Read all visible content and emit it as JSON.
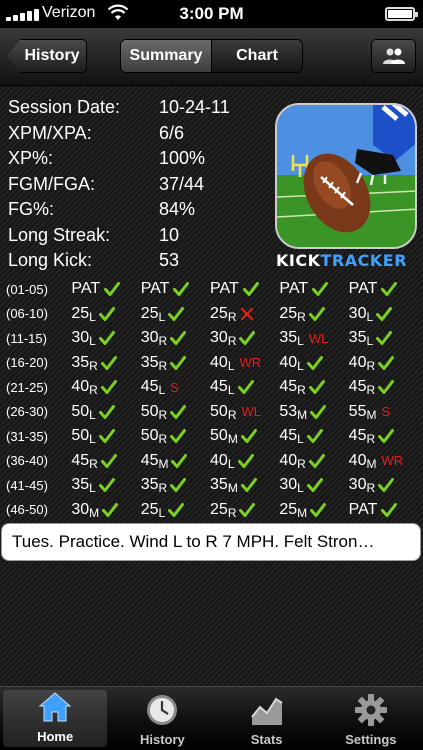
{
  "status": {
    "carrier": "Verizon",
    "time": "3:00 PM"
  },
  "nav": {
    "back_label": "History",
    "segments": [
      {
        "label": "Summary",
        "active": true
      },
      {
        "label": "Chart",
        "active": false
      }
    ],
    "right_icon": "person-icon"
  },
  "summary": [
    {
      "label": "Session Date:",
      "value": "10-24-11"
    },
    {
      "label": "XPM/XPA:",
      "value": "6/6"
    },
    {
      "label": "XP%:",
      "value": "100%"
    },
    {
      "label": "FGM/FGA:",
      "value": "37/44"
    },
    {
      "label": "FG%:",
      "value": "84%"
    },
    {
      "label": "Long Streak:",
      "value": "10"
    },
    {
      "label": "Long Kick:",
      "value": "53"
    }
  ],
  "logo": {
    "part1": "KICK",
    "part2": "TRACKER"
  },
  "kicks": [
    {
      "range": "(01-05)",
      "cells": [
        {
          "dist": "PAT",
          "dir": "",
          "made": true,
          "miss": ""
        },
        {
          "dist": "PAT",
          "dir": "",
          "made": true,
          "miss": ""
        },
        {
          "dist": "PAT",
          "dir": "",
          "made": true,
          "miss": ""
        },
        {
          "dist": "PAT",
          "dir": "",
          "made": true,
          "miss": ""
        },
        {
          "dist": "PAT",
          "dir": "",
          "made": true,
          "miss": ""
        }
      ]
    },
    {
      "range": "(06-10)",
      "cells": [
        {
          "dist": "25",
          "dir": "L",
          "made": true,
          "miss": ""
        },
        {
          "dist": "25",
          "dir": "L",
          "made": true,
          "miss": ""
        },
        {
          "dist": "25",
          "dir": "R",
          "made": false,
          "miss": "X"
        },
        {
          "dist": "25",
          "dir": "R",
          "made": true,
          "miss": ""
        },
        {
          "dist": "30",
          "dir": "L",
          "made": true,
          "miss": ""
        }
      ]
    },
    {
      "range": "(11-15)",
      "cells": [
        {
          "dist": "30",
          "dir": "L",
          "made": true,
          "miss": ""
        },
        {
          "dist": "30",
          "dir": "R",
          "made": true,
          "miss": ""
        },
        {
          "dist": "30",
          "dir": "R",
          "made": true,
          "miss": ""
        },
        {
          "dist": "35",
          "dir": "L",
          "made": false,
          "miss": "WL"
        },
        {
          "dist": "35",
          "dir": "L",
          "made": true,
          "miss": ""
        }
      ]
    },
    {
      "range": "(16-20)",
      "cells": [
        {
          "dist": "35",
          "dir": "R",
          "made": true,
          "miss": ""
        },
        {
          "dist": "35",
          "dir": "R",
          "made": true,
          "miss": ""
        },
        {
          "dist": "40",
          "dir": "L",
          "made": false,
          "miss": "WR"
        },
        {
          "dist": "40",
          "dir": "L",
          "made": true,
          "miss": ""
        },
        {
          "dist": "40",
          "dir": "R",
          "made": true,
          "miss": ""
        }
      ]
    },
    {
      "range": "(21-25)",
      "cells": [
        {
          "dist": "40",
          "dir": "R",
          "made": true,
          "miss": ""
        },
        {
          "dist": "45",
          "dir": "L",
          "made": false,
          "miss": "S"
        },
        {
          "dist": "45",
          "dir": "L",
          "made": true,
          "miss": ""
        },
        {
          "dist": "45",
          "dir": "R",
          "made": true,
          "miss": ""
        },
        {
          "dist": "45",
          "dir": "R",
          "made": true,
          "miss": ""
        }
      ]
    },
    {
      "range": "(26-30)",
      "cells": [
        {
          "dist": "50",
          "dir": "L",
          "made": true,
          "miss": ""
        },
        {
          "dist": "50",
          "dir": "R",
          "made": true,
          "miss": ""
        },
        {
          "dist": "50",
          "dir": "R",
          "made": false,
          "miss": "WL"
        },
        {
          "dist": "53",
          "dir": "M",
          "made": true,
          "miss": ""
        },
        {
          "dist": "55",
          "dir": "M",
          "made": false,
          "miss": "S"
        }
      ]
    },
    {
      "range": "(31-35)",
      "cells": [
        {
          "dist": "50",
          "dir": "L",
          "made": true,
          "miss": ""
        },
        {
          "dist": "50",
          "dir": "R",
          "made": true,
          "miss": ""
        },
        {
          "dist": "50",
          "dir": "M",
          "made": true,
          "miss": ""
        },
        {
          "dist": "45",
          "dir": "L",
          "made": true,
          "miss": ""
        },
        {
          "dist": "45",
          "dir": "R",
          "made": true,
          "miss": ""
        }
      ]
    },
    {
      "range": "(36-40)",
      "cells": [
        {
          "dist": "45",
          "dir": "R",
          "made": true,
          "miss": ""
        },
        {
          "dist": "45",
          "dir": "M",
          "made": true,
          "miss": ""
        },
        {
          "dist": "40",
          "dir": "L",
          "made": true,
          "miss": ""
        },
        {
          "dist": "40",
          "dir": "R",
          "made": true,
          "miss": ""
        },
        {
          "dist": "40",
          "dir": "M",
          "made": false,
          "miss": "WR"
        }
      ]
    },
    {
      "range": "(41-45)",
      "cells": [
        {
          "dist": "35",
          "dir": "L",
          "made": true,
          "miss": ""
        },
        {
          "dist": "35",
          "dir": "R",
          "made": true,
          "miss": ""
        },
        {
          "dist": "35",
          "dir": "M",
          "made": true,
          "miss": ""
        },
        {
          "dist": "30",
          "dir": "L",
          "made": true,
          "miss": ""
        },
        {
          "dist": "30",
          "dir": "R",
          "made": true,
          "miss": ""
        }
      ]
    },
    {
      "range": "(46-50)",
      "cells": [
        {
          "dist": "30",
          "dir": "M",
          "made": true,
          "miss": ""
        },
        {
          "dist": "25",
          "dir": "L",
          "made": true,
          "miss": ""
        },
        {
          "dist": "25",
          "dir": "R",
          "made": true,
          "miss": ""
        },
        {
          "dist": "25",
          "dir": "M",
          "made": true,
          "miss": ""
        },
        {
          "dist": "PAT",
          "dir": "",
          "made": true,
          "miss": ""
        }
      ]
    }
  ],
  "note": "Tues. Practice. Wind L to R 7 MPH. Felt Stron…",
  "tabs": [
    {
      "label": "Home",
      "icon": "home-icon",
      "active": true
    },
    {
      "label": "History",
      "icon": "clock-icon",
      "active": false
    },
    {
      "label": "Stats",
      "icon": "chart-icon",
      "active": false
    },
    {
      "label": "Settings",
      "icon": "gear-icon",
      "active": false
    }
  ],
  "colors": {
    "check": "#7cd11c",
    "miss": "#e0201c",
    "logo_accent": "#3ea0ff"
  }
}
